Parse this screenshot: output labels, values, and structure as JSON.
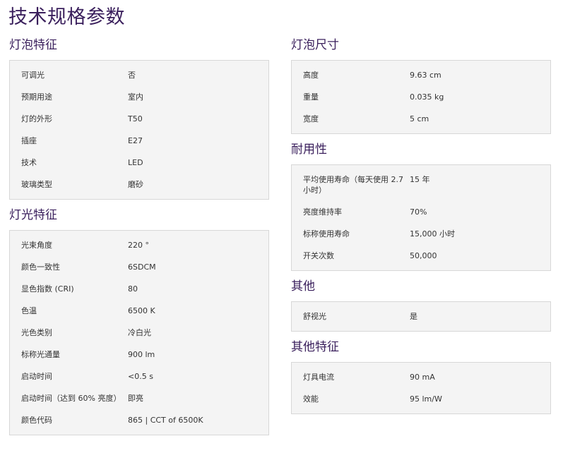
{
  "page_title": "技术规格参数",
  "left": [
    {
      "title": "灯泡特征",
      "rows": [
        {
          "k": "可调光",
          "v": "否"
        },
        {
          "k": "预期用途",
          "v": "室内"
        },
        {
          "k": "灯的外形",
          "v": "T50"
        },
        {
          "k": "插座",
          "v": "E27"
        },
        {
          "k": "技术",
          "v": "LED"
        },
        {
          "k": "玻璃类型",
          "v": "磨砂"
        }
      ]
    },
    {
      "title": "灯光特征",
      "rows": [
        {
          "k": "光束角度",
          "v": "220 °"
        },
        {
          "k": "颜色一致性",
          "v": "6SDCM"
        },
        {
          "k": "显色指数 (CRI)",
          "v": "80"
        },
        {
          "k": "色温",
          "v": "6500 K"
        },
        {
          "k": "光色类别",
          "v": "冷白光"
        },
        {
          "k": "标称光通量",
          "v": "900 lm"
        },
        {
          "k": "启动时间",
          "v": "<0.5 s"
        },
        {
          "k": "启动时间（达到 60% 亮度）",
          "v": "即亮"
        },
        {
          "k": "颜色代码",
          "v": "865 | CCT of 6500K"
        }
      ]
    }
  ],
  "right": [
    {
      "title": "灯泡尺寸",
      "rows": [
        {
          "k": "高度",
          "v": "9.63 cm"
        },
        {
          "k": "重量",
          "v": "0.035 kg"
        },
        {
          "k": "宽度",
          "v": "5 cm"
        }
      ]
    },
    {
      "title": "耐用性",
      "rows": [
        {
          "k": "平均使用寿命（每天使用 2.7 小时）",
          "v": "15 年"
        },
        {
          "k": "亮度维持率",
          "v": "70%"
        },
        {
          "k": "标称使用寿命",
          "v": "15,000 小时"
        },
        {
          "k": "开关次数",
          "v": "50,000"
        }
      ]
    },
    {
      "title": "其他",
      "rows": [
        {
          "k": "舒视光",
          "v": "是"
        }
      ]
    },
    {
      "title": "其他特征",
      "rows": [
        {
          "k": "灯具电流",
          "v": "90 mA"
        },
        {
          "k": "效能",
          "v": "95 lm/W"
        }
      ]
    }
  ]
}
